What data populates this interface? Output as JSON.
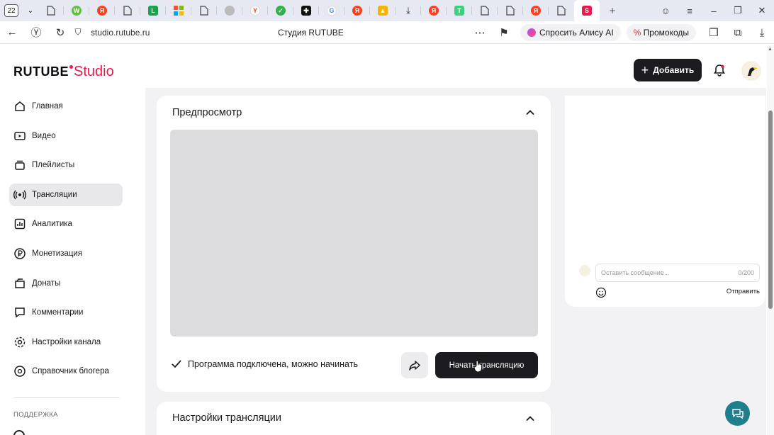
{
  "browser": {
    "tab_count": "22",
    "url": "studio.rutube.ru",
    "page_title": "Студия RUTUBE",
    "alice_label": "Спросить Алису AI",
    "promo_label": "Промокоды"
  },
  "header": {
    "logo_main": "RUTUBE",
    "logo_studio": "Studio",
    "add_label": "Добавить"
  },
  "sidebar": {
    "items": [
      {
        "label": "Главная",
        "icon": "home-icon"
      },
      {
        "label": "Видео",
        "icon": "video-icon"
      },
      {
        "label": "Плейлисты",
        "icon": "playlist-icon"
      },
      {
        "label": "Трансляции",
        "icon": "broadcast-icon",
        "active": true
      },
      {
        "label": "Аналитика",
        "icon": "analytics-icon"
      },
      {
        "label": "Монетизация",
        "icon": "ruble-icon"
      },
      {
        "label": "Донаты",
        "icon": "donate-icon"
      },
      {
        "label": "Комментарии",
        "icon": "comments-icon"
      },
      {
        "label": "Настройки канала",
        "icon": "gear-icon"
      },
      {
        "label": "Справочник блогера",
        "icon": "help-icon"
      }
    ],
    "section_label": "ПОДДЕРЖКА"
  },
  "preview": {
    "title": "Предпросмотр",
    "status": "Программа подключена, можно начинать",
    "start_label": "Начать трансляцию"
  },
  "settings": {
    "title": "Настройки трансляции"
  },
  "chat": {
    "placeholder": "Оставить сообщение...",
    "counter": "0/200",
    "send_label": "Отправить"
  },
  "colors": {
    "accent": "#ed1849",
    "dark_button": "#1c1c20",
    "help_fab": "#1f7f8c"
  }
}
